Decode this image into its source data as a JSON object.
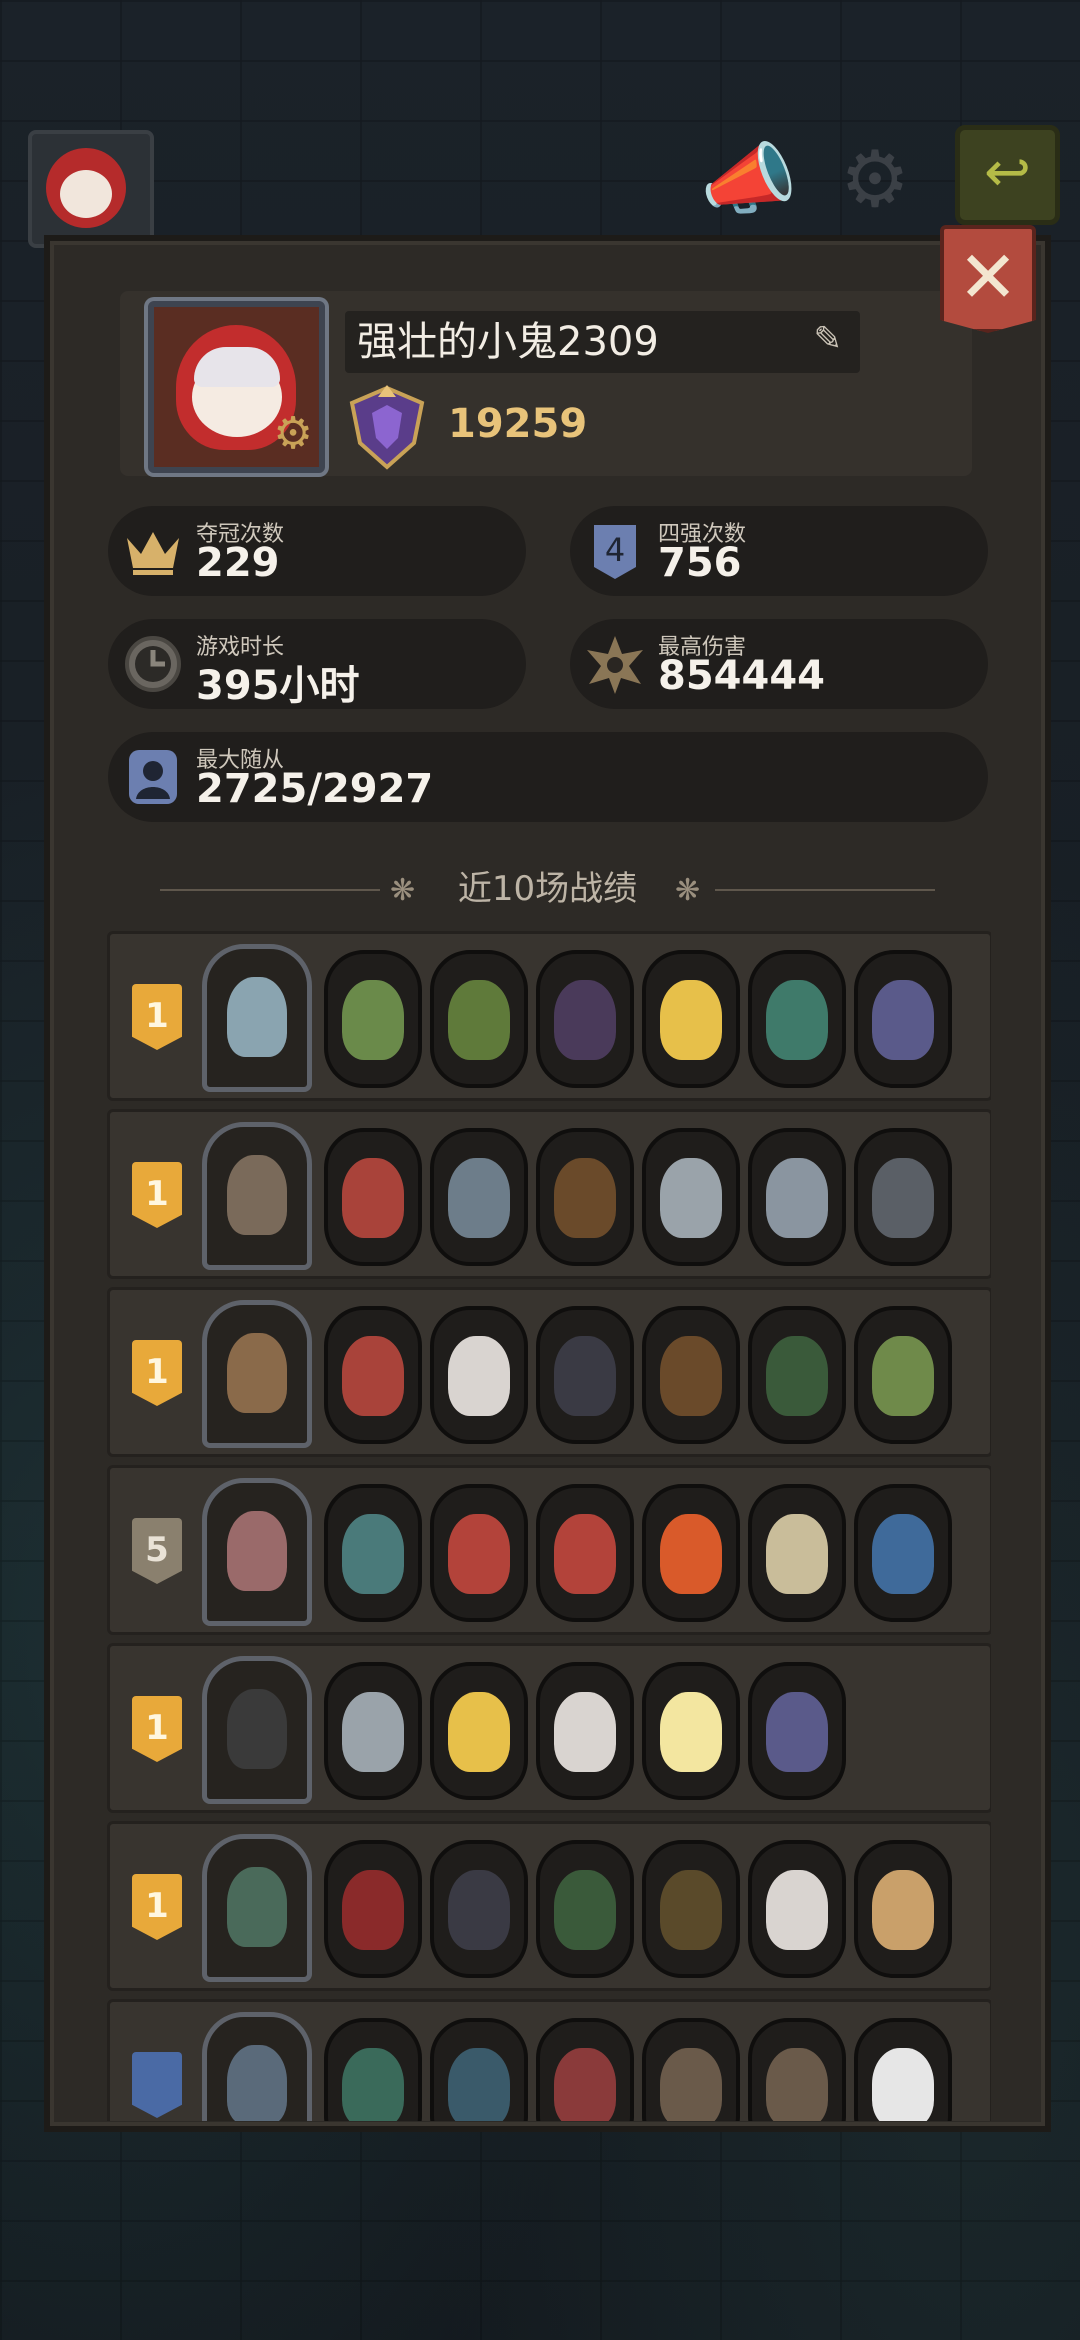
{
  "profile": {
    "name": "强壮的小鬼2309",
    "score": "19259"
  },
  "stats": {
    "champion_label": "夺冠次数",
    "champion_value": "229",
    "top4_label": "四强次数",
    "top4_value": "756",
    "playtime_label": "游戏时长",
    "playtime_value": "395小时",
    "max_damage_label": "最高伤害",
    "max_damage_value": "854444",
    "max_minions_label": "最大随从",
    "max_minions_value": "2725/2927"
  },
  "section_title": "近10场战绩",
  "matches": [
    {
      "place": "1",
      "medal": "gold",
      "hero_color": "#8aa4b0",
      "units": [
        "#6a8a4a",
        "#5f7a3a",
        "#4a3a5a",
        "#e7c04a",
        "#3f7a6a",
        "#5a5a8a"
      ]
    },
    {
      "place": "1",
      "medal": "gold",
      "hero_color": "#7a6a5a",
      "units": [
        "#a9433a",
        "#6d7d8a",
        "#6a4a2a",
        "#9aa3aa",
        "#8a95a0",
        "#5a5f66"
      ]
    },
    {
      "place": "1",
      "medal": "gold",
      "hero_color": "#8a6a4a",
      "units": [
        "#a9433a",
        "#d9d4d0",
        "#3a3a44",
        "#6a4a2a",
        "#3a5a3a",
        "#6f8a4a"
      ]
    },
    {
      "place": "5",
      "medal": "silver",
      "hero_color": "#9a6a6a",
      "units": [
        "#4a7a7a",
        "#b3433a",
        "#b3433a",
        "#d95a2a",
        "#c9bd9a",
        "#3f6a9a"
      ]
    },
    {
      "place": "1",
      "medal": "gold",
      "hero_color": "#3a3a3a",
      "units": [
        "#9aa3aa",
        "#e7c04a",
        "#d9d4d0",
        "#f3e6a0",
        "#5a5a8a"
      ]
    },
    {
      "place": "1",
      "medal": "gold",
      "hero_color": "#4a6a5a",
      "units": [
        "#8a2a2a",
        "#3a3a44",
        "#3a5a3a",
        "#5a4a2a",
        "#d9d4d0",
        "#c9a06a"
      ]
    },
    {
      "place": "",
      "medal": "blue",
      "hero_color": "#5a6a7a",
      "units": [
        "#3a6a5a",
        "#3a5a6a",
        "#8a3a3a",
        "#6a5a4a",
        "#6a5a4a",
        "#e6e6e6"
      ]
    }
  ]
}
